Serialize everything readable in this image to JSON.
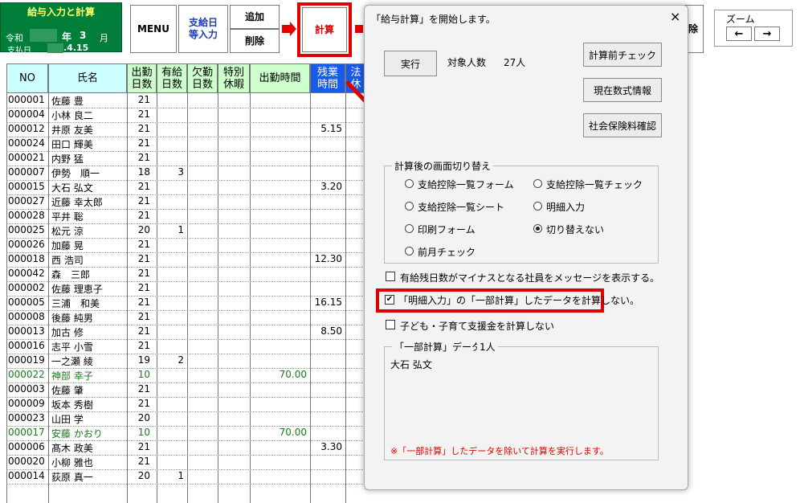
{
  "header": {
    "title": "給与入力と計算",
    "era": "令和",
    "year_suffix": "年",
    "month": "3",
    "month_suffix": "月",
    "pay_date_label": "支払日",
    "pay_date": ".4.15"
  },
  "toolbar": {
    "menu": "MENU",
    "pay_date_entry": [
      "支給日",
      "等入力"
    ],
    "add": "追加",
    "delete": "削除",
    "calc": "計算",
    "partial_right": "除",
    "zoom_label": "ズーム",
    "zoom_left": "←",
    "zoom_right": "→"
  },
  "table": {
    "headers": {
      "no": "NO",
      "name": "氏名",
      "work_days": [
        "出勤",
        "日数"
      ],
      "paid_leave": [
        "有給",
        "日数"
      ],
      "absence": [
        "欠勤",
        "日数"
      ],
      "special_leave": [
        "特別",
        "休暇"
      ],
      "work_time": "出勤時間",
      "overtime": [
        "残業",
        "時間"
      ],
      "legal": [
        "法",
        "休"
      ]
    },
    "rows": [
      {
        "no": "000001",
        "name": "佐藤 豊",
        "days": "21",
        "paid": "",
        "wtime": "",
        "ot": "",
        "green": false
      },
      {
        "no": "000004",
        "name": "小林 良二",
        "days": "21",
        "paid": "",
        "wtime": "",
        "ot": "",
        "green": false
      },
      {
        "no": "000012",
        "name": "井原 友美",
        "days": "21",
        "paid": "",
        "wtime": "",
        "ot": "5.15",
        "green": false
      },
      {
        "no": "000024",
        "name": "田口 輝美",
        "days": "21",
        "paid": "",
        "wtime": "",
        "ot": "",
        "green": false
      },
      {
        "no": "000021",
        "name": "内野 猛",
        "days": "21",
        "paid": "",
        "wtime": "",
        "ot": "",
        "green": false
      },
      {
        "no": "000007",
        "name": "伊勢　順一",
        "days": "18",
        "paid": "3",
        "wtime": "",
        "ot": "",
        "green": false
      },
      {
        "no": "000015",
        "name": "大石 弘文",
        "days": "21",
        "paid": "",
        "wtime": "",
        "ot": "3.20",
        "green": false
      },
      {
        "no": "000027",
        "name": "近藤 幸太郎",
        "days": "21",
        "paid": "",
        "wtime": "",
        "ot": "",
        "green": false
      },
      {
        "no": "000028",
        "name": "平井 聡",
        "days": "21",
        "paid": "",
        "wtime": "",
        "ot": "",
        "green": false
      },
      {
        "no": "000025",
        "name": "松元 涼",
        "days": "20",
        "paid": "1",
        "wtime": "",
        "ot": "",
        "green": false
      },
      {
        "no": "000026",
        "name": "加藤 晃",
        "days": "21",
        "paid": "",
        "wtime": "",
        "ot": "",
        "green": false
      },
      {
        "no": "000018",
        "name": "西 浩司",
        "days": "21",
        "paid": "",
        "wtime": "",
        "ot": "12.30",
        "green": false
      },
      {
        "no": "000042",
        "name": "森　三郎",
        "days": "21",
        "paid": "",
        "wtime": "",
        "ot": "",
        "green": false
      },
      {
        "no": "000002",
        "name": "佐藤 理恵子",
        "days": "21",
        "paid": "",
        "wtime": "",
        "ot": "",
        "green": false
      },
      {
        "no": "000005",
        "name": "三浦　和美",
        "days": "21",
        "paid": "",
        "wtime": "",
        "ot": "16.15",
        "green": false
      },
      {
        "no": "000008",
        "name": "後藤 純男",
        "days": "21",
        "paid": "",
        "wtime": "",
        "ot": "",
        "green": false
      },
      {
        "no": "000013",
        "name": "加古 修",
        "days": "21",
        "paid": "",
        "wtime": "",
        "ot": "8.50",
        "green": false
      },
      {
        "no": "000016",
        "name": "志平 小雪",
        "days": "21",
        "paid": "",
        "wtime": "",
        "ot": "",
        "green": false
      },
      {
        "no": "000019",
        "name": "一之瀬 綾",
        "days": "19",
        "paid": "2",
        "wtime": "",
        "ot": "",
        "green": false
      },
      {
        "no": "000022",
        "name": "神部 幸子",
        "days": "10",
        "paid": "",
        "wtime": "70.00",
        "ot": "",
        "green": true
      },
      {
        "no": "000003",
        "name": "佐藤 肇",
        "days": "21",
        "paid": "",
        "wtime": "",
        "ot": "",
        "green": false
      },
      {
        "no": "000009",
        "name": "坂本 秀樹",
        "days": "21",
        "paid": "",
        "wtime": "",
        "ot": "",
        "green": false
      },
      {
        "no": "000023",
        "name": "山田 学",
        "days": "20",
        "paid": "",
        "wtime": "",
        "ot": "",
        "green": false
      },
      {
        "no": "000017",
        "name": "安藤 かおり",
        "days": "10",
        "paid": "",
        "wtime": "70.00",
        "ot": "",
        "green": true
      },
      {
        "no": "000006",
        "name": "髙木 政美",
        "days": "21",
        "paid": "",
        "wtime": "",
        "ot": "3.30",
        "green": false
      },
      {
        "no": "000020",
        "name": "小柳 雅也",
        "days": "21",
        "paid": "",
        "wtime": "",
        "ot": "",
        "green": false
      },
      {
        "no": "000014",
        "name": "荻原 真一",
        "days": "20",
        "paid": "1",
        "wtime": "",
        "ot": "",
        "green": false
      }
    ]
  },
  "dialog": {
    "title": "「給与計算」を開始します。",
    "close": "×",
    "run": "実行",
    "target_label": "対象人数",
    "target_count": "27人",
    "pre_check": "計算前チェック",
    "formula_info": "現在数式情報",
    "insurance_check": "社会保険料確認",
    "group_title": "計算後の画面切り替え",
    "options": [
      "支給控除一覧フォーム",
      "支給控除一覧チェック",
      "支給控除一覧シート",
      "明細入力",
      "印刷フォーム",
      "切り替えない",
      "前月チェック"
    ],
    "selected_option": "切り替えない",
    "check1": "有給残日数がマイナスとなる社員をメッセージを表示する。",
    "check2": "「明細入力」の「一部計算」したデータを計算しない。",
    "check3": "子ども・子育て支援金を計算しない",
    "partial_title": "「一部計算」データ",
    "partial_count": "1人",
    "partial_name": "大石 弘文",
    "note": "※「一部計算」したデータを除いて計算を実行します。"
  },
  "colors": {
    "accent_red": "#e00000",
    "title_green": "#007e3a",
    "header_green": "#ccffcc",
    "header_blue": "#1a5ae6",
    "note_red": "#e00000"
  }
}
